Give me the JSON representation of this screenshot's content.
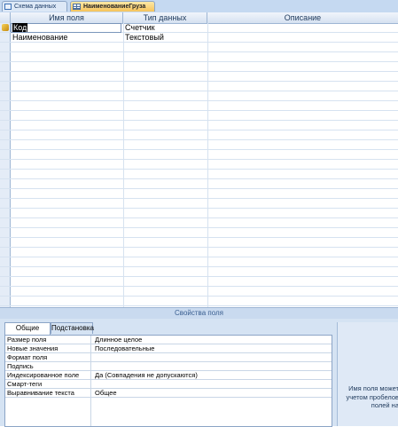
{
  "tabs": [
    {
      "label": "Схема данных",
      "icon": "relationships-icon",
      "active": false
    },
    {
      "label": "НаименованиеГруза",
      "icon": "table-icon",
      "active": true
    }
  ],
  "grid": {
    "columns": [
      "Имя поля",
      "Тип данных",
      "Описание"
    ],
    "rows": [
      {
        "name": "Код",
        "type": "Счетчик",
        "description": "",
        "primary_key": true
      },
      {
        "name": "Наименование",
        "type": "Текстовый",
        "description": "",
        "primary_key": false
      }
    ]
  },
  "properties_title": "Свойства поля",
  "property_tabs": [
    "Общие",
    "Подстановка"
  ],
  "properties": [
    {
      "name": "Размер поля",
      "value": "Длинное целое"
    },
    {
      "name": "Новые значения",
      "value": "Последовательные"
    },
    {
      "name": "Формат поля",
      "value": ""
    },
    {
      "name": "Подпись",
      "value": ""
    },
    {
      "name": "Индексированное поле",
      "value": "Да (Совпадения не допускаются)"
    },
    {
      "name": "Смарт-теги",
      "value": ""
    },
    {
      "name": "Выравнивание текста",
      "value": "Общее"
    }
  ],
  "help_lines": [
    "Имя поля может",
    "учетом пробелов",
    "полей на"
  ]
}
